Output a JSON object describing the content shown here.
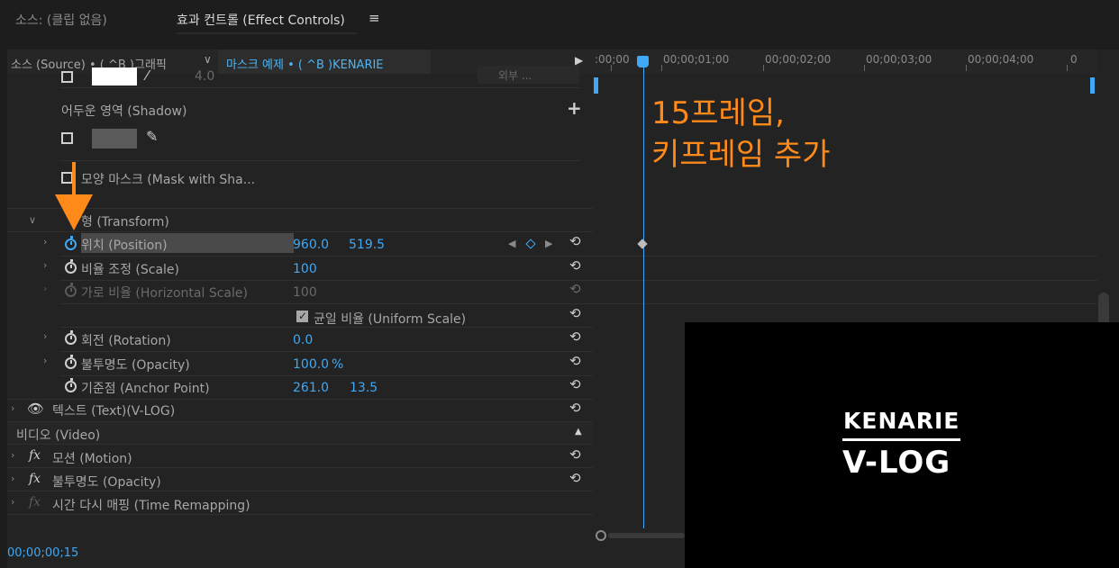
{
  "tabs": {
    "source": "소스: (클립 없음)",
    "effect_controls": "효과 컨트롤 (Effect Controls)",
    "menu_glyph": "≡"
  },
  "header": {
    "source_label": "소스 (Source) • ( ^B )그래픽",
    "chevron": "∨",
    "clip_label": "마스크 예제 • ( ^B )KENARIE",
    "play_glyph": "▶"
  },
  "rows": {
    "partial_value": "4.0",
    "partial_dropdown": "외부 ...",
    "shadow_label": "어두운 영역 (Shadow)",
    "shadow_add": "+",
    "mask_label": "모양 마스크 (Mask with Sha...",
    "transform_label": "형 (Transform)",
    "position_label": "위치 (Position)",
    "position_x": "960.0",
    "position_y": "519.5",
    "scale_label": "비율 조정 (Scale)",
    "scale_value": "100",
    "hscale_label": "가로 비율 (Horizontal Scale)",
    "hscale_value": "100",
    "uniform_label": "균일 비율 (Uniform Scale)",
    "rotation_label": "회전 (Rotation)",
    "rotation_value": "0.0",
    "opacity_label": "불투명도 (Opacity)",
    "opacity_value": "100.0",
    "opacity_unit": "%",
    "anchor_label": "기준점 (Anchor Point)",
    "anchor_x": "261.0",
    "anchor_y": "13.5",
    "text_label": "텍스트 (Text)(V-LOG)",
    "video_label": "비디오 (Video)",
    "motion_label": "모션 (Motion)",
    "opacity2_label": "불투명도 (Opacity)",
    "timeremap_label": "시간 다시 매핑 (Time Remapping)",
    "fx_glyph": "fx",
    "reset_glyph": "⟲"
  },
  "timeline": {
    "ruler": [
      ":00;00",
      "00;00;01;00",
      "00;00;02;00",
      "00;00;03;00",
      "00;00;04;00"
    ]
  },
  "annotation": {
    "line1": "15프레임,",
    "line2": "키프레임 추가"
  },
  "preview": {
    "title_line1": "KENARIE",
    "title_line2": "V-LOG"
  },
  "status": {
    "timecode": "00;00;00;15"
  },
  "colors": {
    "accent": "#3fa9f5",
    "annotation": "#ff8a1a",
    "panel": "#232323"
  }
}
